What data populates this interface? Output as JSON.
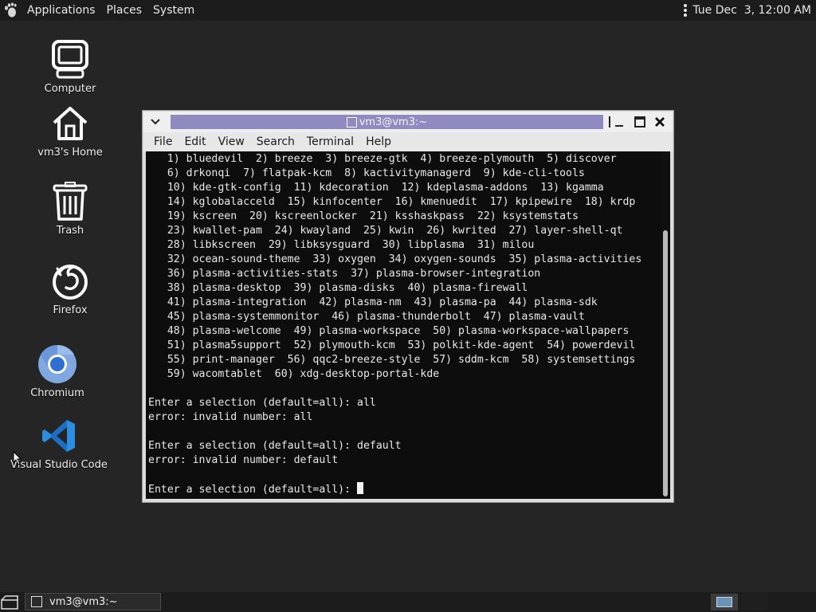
{
  "top_panel": {
    "menus": [
      "Applications",
      "Places",
      "System"
    ],
    "clock": "Tue Dec  3, 12:00 AM"
  },
  "desktop_icons": [
    {
      "label": "Computer",
      "icon": "computer-icon"
    },
    {
      "label": "vm3's Home",
      "icon": "home-folder-icon"
    },
    {
      "label": "Trash",
      "icon": "trash-icon"
    },
    {
      "label": "Firefox",
      "icon": "firefox-icon"
    },
    {
      "label": "Chromium",
      "icon": "chromium-icon"
    },
    {
      "label": "Visual Studio Code",
      "icon": "vscode-icon"
    }
  ],
  "terminal": {
    "title": "vm3@vm3:~",
    "menu": [
      "File",
      "Edit",
      "View",
      "Search",
      "Terminal",
      "Help"
    ],
    "lines": [
      "   1) bluedevil  2) breeze  3) breeze-gtk  4) breeze-plymouth  5) discover",
      "   6) drkonqi  7) flatpak-kcm  8) kactivitymanagerd  9) kde-cli-tools",
      "   10) kde-gtk-config  11) kdecoration  12) kdeplasma-addons  13) kgamma",
      "   14) kglobalacceld  15) kinfocenter  16) kmenuedit  17) kpipewire  18) krdp",
      "   19) kscreen  20) kscreenlocker  21) ksshaskpass  22) ksystemstats",
      "   23) kwallet-pam  24) kwayland  25) kwin  26) kwrited  27) layer-shell-qt",
      "   28) libkscreen  29) libksysguard  30) libplasma  31) milou",
      "   32) ocean-sound-theme  33) oxygen  34) oxygen-sounds  35) plasma-activities",
      "   36) plasma-activities-stats  37) plasma-browser-integration",
      "   38) plasma-desktop  39) plasma-disks  40) plasma-firewall",
      "   41) plasma-integration  42) plasma-nm  43) plasma-pa  44) plasma-sdk",
      "   45) plasma-systemmonitor  46) plasma-thunderbolt  47) plasma-vault",
      "   48) plasma-welcome  49) plasma-workspace  50) plasma-workspace-wallpapers",
      "   51) plasma5support  52) plymouth-kcm  53) polkit-kde-agent  54) powerdevil",
      "   55) print-manager  56) qqc2-breeze-style  57) sddm-kcm  58) systemsettings",
      "   59) wacomtablet  60) xdg-desktop-portal-kde",
      "",
      "Enter a selection (default=all): all",
      "error: invalid number: all",
      "",
      "Enter a selection (default=all): default",
      "error: invalid number: default",
      ""
    ],
    "prompt": "Enter a selection (default=all): "
  },
  "taskbar": {
    "window_button": "vm3@vm3:~"
  }
}
